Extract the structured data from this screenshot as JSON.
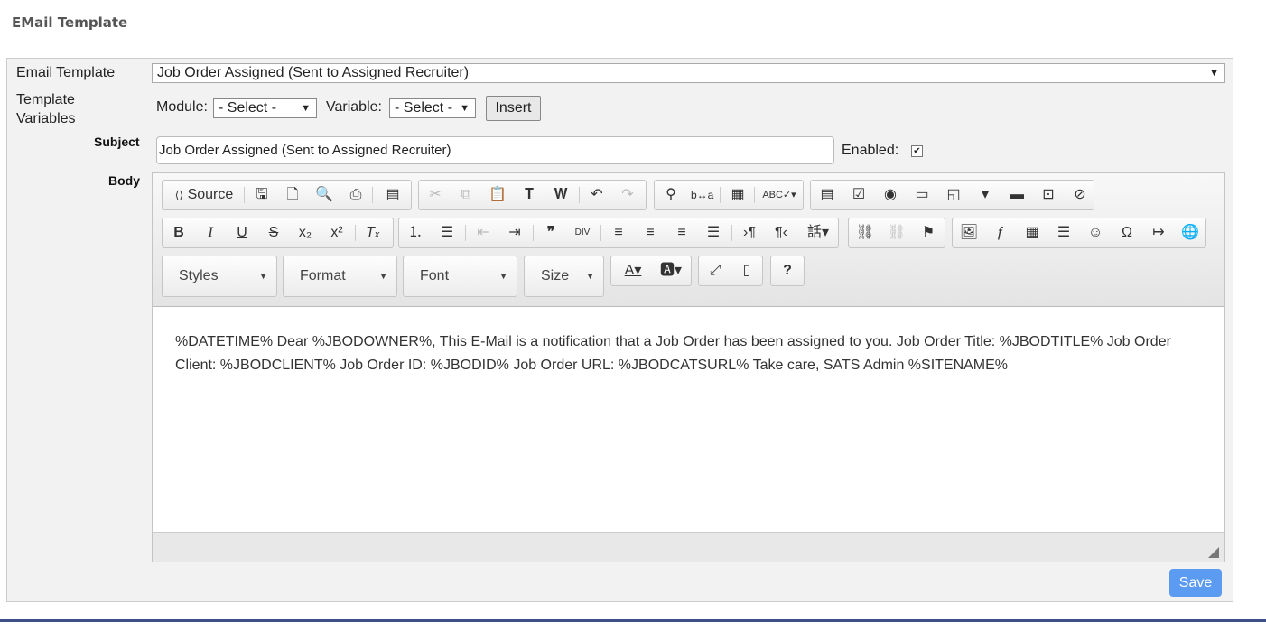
{
  "page": {
    "title": "EMail Template"
  },
  "form": {
    "email_template_label": "Email Template",
    "email_template_value": "Job Order Assigned (Sent to Assigned Recruiter)",
    "template_variables_label_line1": "Template",
    "template_variables_label_line2": "Variables",
    "module_label": "Module:",
    "module_value": "- Select -",
    "variable_label": "Variable:",
    "variable_value": "- Select -",
    "insert_label": "Insert",
    "subject_label": "Subject",
    "subject_value": "Job Order Assigned (Sent to Assigned Recruiter)",
    "enabled_label": "Enabled:",
    "enabled_checked": true,
    "body_label": "Body",
    "save_label": "Save"
  },
  "editor": {
    "source_label": "Source",
    "combos": {
      "styles": "Styles",
      "format": "Format",
      "font": "Font",
      "size": "Size"
    },
    "content": "%DATETIME% Dear %JBODOWNER%, This E-Mail is a notification that a Job Order has been assigned to you. Job Order Title: %JBODTITLE% Job Order Client: %JBODCLIENT% Job Order ID: %JBODID% Job Order URL: %JBODCATSURL% Take care, SATS Admin %SITENAME%"
  },
  "colors": {
    "save_button": "#5b9bf2",
    "panel_bg": "#f2f2f2",
    "bottom_bar": "#3d4f86"
  }
}
